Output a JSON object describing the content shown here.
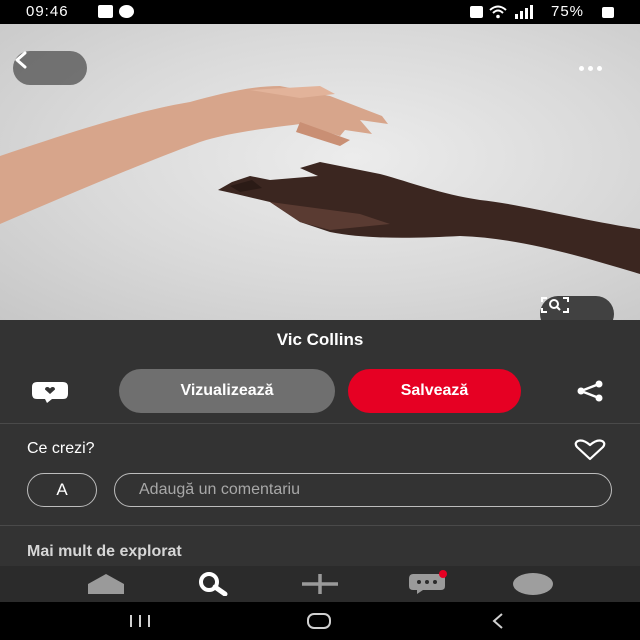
{
  "status_bar": {
    "time": "09:46",
    "battery": "75%",
    "icons": [
      "gallery-icon",
      "whatsapp-icon",
      "camera-icon",
      "wifi-icon",
      "signal-icon",
      "battery-icon"
    ]
  },
  "hero": {
    "image_alt": "hands-reaching-photo",
    "icons": {
      "back": "chevron-left-icon",
      "more": "more-icon",
      "lens": "visual-search-icon"
    }
  },
  "pin": {
    "author": "Vic Collins",
    "view_button": "Vizualizează",
    "save_button": "Salvează",
    "save_color": "#e60023"
  },
  "comments": {
    "title": "Ce crezi?",
    "avatar_initial": "A",
    "placeholder": "Adaugă un comentariu"
  },
  "more_section": {
    "title": "Mai mult de explorat"
  },
  "bottom_nav": {
    "items": [
      "home-icon",
      "search-icon",
      "create-icon",
      "messages-icon",
      "profile-avatar"
    ],
    "notification_color": "#e60023"
  },
  "system_nav": {
    "items": [
      "recent-apps-icon",
      "home-button-icon",
      "back-icon"
    ]
  }
}
